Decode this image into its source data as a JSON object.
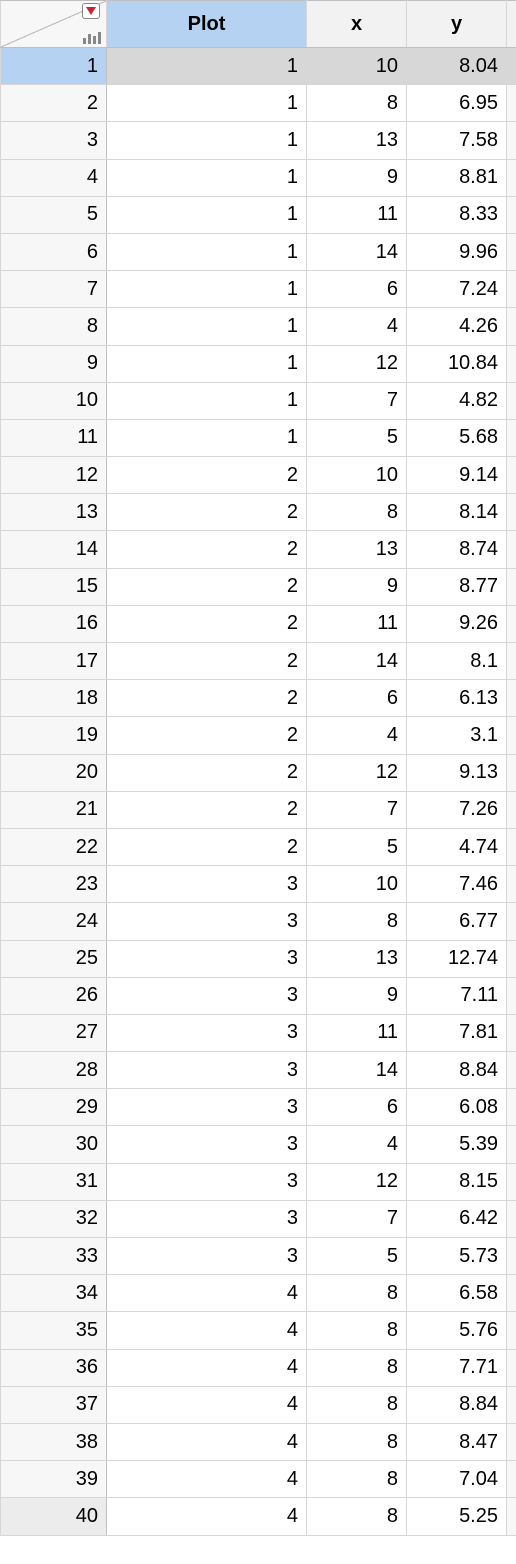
{
  "columns": {
    "plot": "Plot",
    "x": "x",
    "y": "y"
  },
  "selected_row_index": 0,
  "rows": [
    {
      "n": "1",
      "plot": "1",
      "x": "10",
      "y": "8.04"
    },
    {
      "n": "2",
      "plot": "1",
      "x": "8",
      "y": "6.95"
    },
    {
      "n": "3",
      "plot": "1",
      "x": "13",
      "y": "7.58"
    },
    {
      "n": "4",
      "plot": "1",
      "x": "9",
      "y": "8.81"
    },
    {
      "n": "5",
      "plot": "1",
      "x": "11",
      "y": "8.33"
    },
    {
      "n": "6",
      "plot": "1",
      "x": "14",
      "y": "9.96"
    },
    {
      "n": "7",
      "plot": "1",
      "x": "6",
      "y": "7.24"
    },
    {
      "n": "8",
      "plot": "1",
      "x": "4",
      "y": "4.26"
    },
    {
      "n": "9",
      "plot": "1",
      "x": "12",
      "y": "10.84"
    },
    {
      "n": "10",
      "plot": "1",
      "x": "7",
      "y": "4.82"
    },
    {
      "n": "11",
      "plot": "1",
      "x": "5",
      "y": "5.68"
    },
    {
      "n": "12",
      "plot": "2",
      "x": "10",
      "y": "9.14"
    },
    {
      "n": "13",
      "plot": "2",
      "x": "8",
      "y": "8.14"
    },
    {
      "n": "14",
      "plot": "2",
      "x": "13",
      "y": "8.74"
    },
    {
      "n": "15",
      "plot": "2",
      "x": "9",
      "y": "8.77"
    },
    {
      "n": "16",
      "plot": "2",
      "x": "11",
      "y": "9.26"
    },
    {
      "n": "17",
      "plot": "2",
      "x": "14",
      "y": "8.1"
    },
    {
      "n": "18",
      "plot": "2",
      "x": "6",
      "y": "6.13"
    },
    {
      "n": "19",
      "plot": "2",
      "x": "4",
      "y": "3.1"
    },
    {
      "n": "20",
      "plot": "2",
      "x": "12",
      "y": "9.13"
    },
    {
      "n": "21",
      "plot": "2",
      "x": "7",
      "y": "7.26"
    },
    {
      "n": "22",
      "plot": "2",
      "x": "5",
      "y": "4.74"
    },
    {
      "n": "23",
      "plot": "3",
      "x": "10",
      "y": "7.46"
    },
    {
      "n": "24",
      "plot": "3",
      "x": "8",
      "y": "6.77"
    },
    {
      "n": "25",
      "plot": "3",
      "x": "13",
      "y": "12.74"
    },
    {
      "n": "26",
      "plot": "3",
      "x": "9",
      "y": "7.11"
    },
    {
      "n": "27",
      "plot": "3",
      "x": "11",
      "y": "7.81"
    },
    {
      "n": "28",
      "plot": "3",
      "x": "14",
      "y": "8.84"
    },
    {
      "n": "29",
      "plot": "3",
      "x": "6",
      "y": "6.08"
    },
    {
      "n": "30",
      "plot": "3",
      "x": "4",
      "y": "5.39"
    },
    {
      "n": "31",
      "plot": "3",
      "x": "12",
      "y": "8.15"
    },
    {
      "n": "32",
      "plot": "3",
      "x": "7",
      "y": "6.42"
    },
    {
      "n": "33",
      "plot": "3",
      "x": "5",
      "y": "5.73"
    },
    {
      "n": "34",
      "plot": "4",
      "x": "8",
      "y": "6.58"
    },
    {
      "n": "35",
      "plot": "4",
      "x": "8",
      "y": "5.76"
    },
    {
      "n": "36",
      "plot": "4",
      "x": "8",
      "y": "7.71"
    },
    {
      "n": "37",
      "plot": "4",
      "x": "8",
      "y": "8.84"
    },
    {
      "n": "38",
      "plot": "4",
      "x": "8",
      "y": "8.47"
    },
    {
      "n": "39",
      "plot": "4",
      "x": "8",
      "y": "7.04"
    },
    {
      "n": "40",
      "plot": "4",
      "x": "8",
      "y": "5.25"
    }
  ]
}
